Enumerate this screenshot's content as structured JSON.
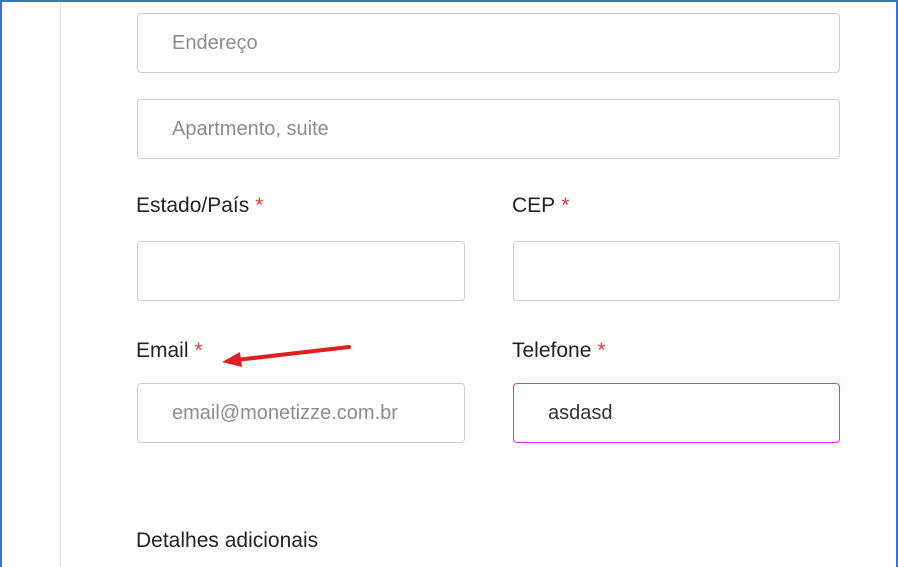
{
  "form": {
    "address": {
      "placeholder": "Endereço",
      "value": ""
    },
    "apartment": {
      "placeholder": "Apartmento, suite",
      "value": ""
    },
    "state": {
      "label": "Estado/País",
      "required": "*",
      "value": ""
    },
    "cep": {
      "label": "CEP",
      "required": "*",
      "value": ""
    },
    "email": {
      "label": "Email",
      "required": "*",
      "placeholder": "email@monetizze.com.br",
      "value": ""
    },
    "phone": {
      "label": "Telefone",
      "required": "*",
      "value": "asdasd"
    },
    "additional_details": {
      "label": "Detalhes adicionais"
    }
  },
  "annotation": {
    "arrow_color": "#e02020"
  },
  "colors": {
    "frame": "#3b73c7",
    "required": "#e03a3a",
    "focus_border": "#e52ce5"
  }
}
